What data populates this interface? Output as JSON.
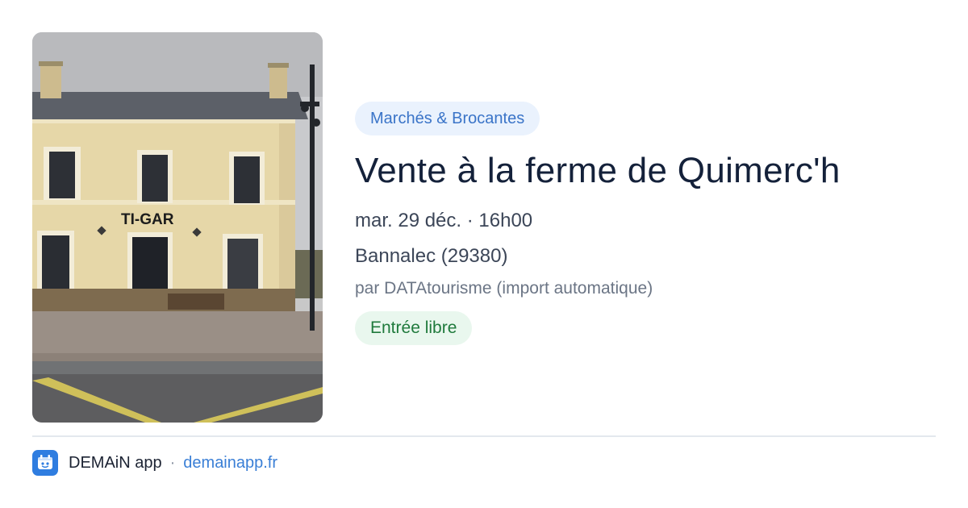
{
  "event": {
    "category": "Marchés & Brocantes",
    "title": "Vente à la ferme de Quimerc'h",
    "datetime": "mar. 29 déc. · 16h00",
    "location": "Bannalec (29380)",
    "organizer": "par DATAtourisme (import automatique)",
    "price": "Entrée libre",
    "photo_sign_text": "TI-GAR"
  },
  "footer": {
    "app_name": "DEMAiN app",
    "separator": "·",
    "link": "demainapp.fr",
    "logo_icon": "app-logo-icon"
  },
  "colors": {
    "category_bg": "#eaf2fd",
    "category_text": "#3a74c8",
    "price_bg": "#e9f7ee",
    "price_text": "#1f7a3c",
    "title": "#14213a",
    "link": "#3a7fd6",
    "brand": "#2f7de0"
  }
}
